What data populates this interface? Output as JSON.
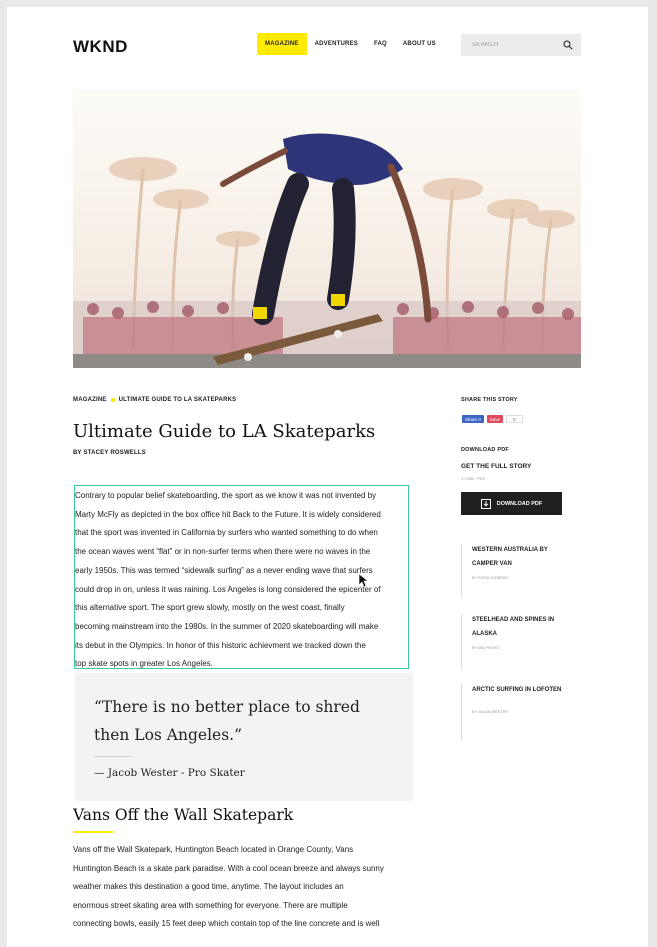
{
  "header": {
    "logo": "WKND",
    "nav": [
      {
        "label": "MAGAZINE",
        "active": true
      },
      {
        "label": "ADVENTURES",
        "active": false
      },
      {
        "label": "FAQ",
        "active": false
      },
      {
        "label": "ABOUT US",
        "active": false
      }
    ],
    "search_placeholder": "SEARCH"
  },
  "article": {
    "breadcrumb": [
      "MAGAZINE",
      "ULTIMATE GUIDE TO LA SKATEPARKS"
    ],
    "title": "Ultimate Guide to LA Skateparks",
    "byline": "BY STACEY ROSWELLS",
    "body_lines": [
      "Contrary to popular belief skateboarding, the sport as we know it was not invented by",
      "Marty McFly as depicted in the box office hit Back to the Future. It is widely considered",
      "that the sport was invented in California by surfers who wanted something to do when",
      "the ocean waves went “flat” or in non-surfer terms when there were no waves in the",
      "early 1950s. This was termed “sidewalk surfing” as a never ending wave that surfers",
      "could drop in on, unless it was raining. Los Angeles is long considered the epicenter of",
      "this alternative sport. The sport grew slowly, mostly on the west coast, finally",
      "becoming mainstream into the 1980s. In the summer of 2020 skateboarding will make",
      "its debut in the Olympics. In honor of this historic achievment we tracked down the",
      "top skate spots in greater Los Angeles."
    ],
    "quote": "“There is no better place to shred then Los Angeles.”",
    "quote_author": "— Jacob Wester - Pro Skater",
    "section_title": "Vans Off the Wall Skatepark",
    "section_lines": [
      "Vans off the Wall Skatepark, Huntington Beach located in Orange County, Vans",
      "Huntington Beach is a skate park paradise. With a cool ocean breeze and always sunny",
      "weather makes this destination a good time, anytime. The layout includes an",
      "enormous street skating area with something for everyone. There are multiple",
      "connecting bowls, easily 15 feet deep which contain top of the line concrete and is well"
    ]
  },
  "sidebar": {
    "share_label": "SHARE THIS STORY",
    "share_fb": "Share 0",
    "share_pin": "Save",
    "share_count": "0",
    "download_label": "DOWNLOAD PDF",
    "get_full": "GET THE FULL STORY",
    "pdf_meta": "1.3 MB · PDF",
    "download_button": "DOWNLOAD PDF",
    "related": [
      {
        "title": "WESTERN AUSTRALIA BY CAMPER VAN",
        "author": "BY SOFIA SJÖBERG"
      },
      {
        "title": "STEELHEAD AND SPINES IN ALASKA",
        "author": "BY IAN PROVO"
      },
      {
        "title": "ARCTIC SURFING IN LOFOTEN",
        "author": "BY JACOB WESTER"
      }
    ]
  },
  "colors": {
    "accent": "#ffea00",
    "focus_border": "#3dc9a0"
  }
}
